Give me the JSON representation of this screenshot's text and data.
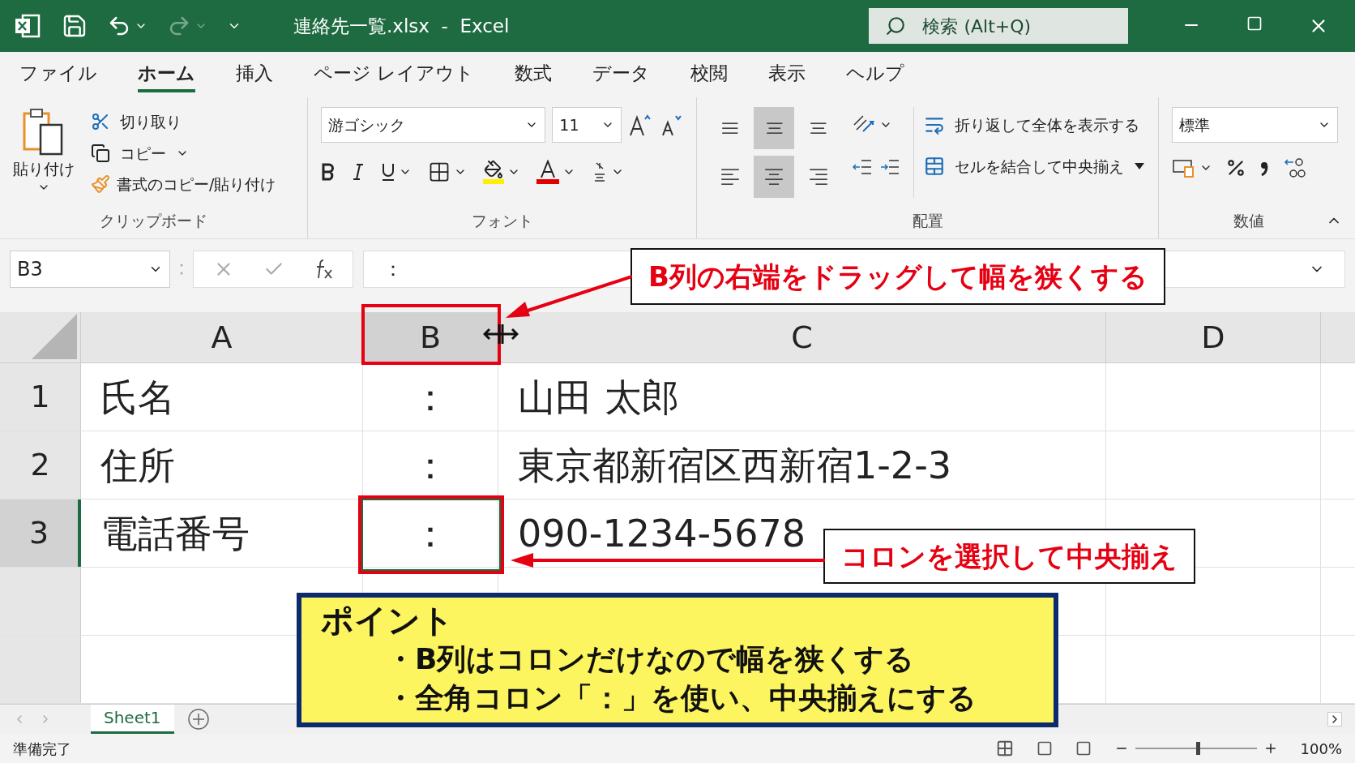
{
  "title_bar": {
    "title": "連絡先一覧.xlsx  -  Excel",
    "search_placeholder": "検索 (Alt+Q)"
  },
  "menu_tabs": [
    {
      "label": "ファイル",
      "selected": false
    },
    {
      "label": "ホーム",
      "selected": true
    },
    {
      "label": "挿入",
      "selected": false
    },
    {
      "label": "ページ レイアウト",
      "selected": false
    },
    {
      "label": "数式",
      "selected": false
    },
    {
      "label": "データ",
      "selected": false
    },
    {
      "label": "校閲",
      "selected": false
    },
    {
      "label": "表示",
      "selected": false
    },
    {
      "label": "ヘルプ",
      "selected": false
    }
  ],
  "clipboard": {
    "paste": "貼り付け",
    "cut": "切り取り",
    "copy": "コピー",
    "format_painter": "書式のコピー/貼り付け",
    "group_label": "クリップボード"
  },
  "font": {
    "name": "游ゴシック",
    "size": "11",
    "group_label": "フォント"
  },
  "alignment": {
    "buttons": [
      {
        "kind": "top",
        "selected": false
      },
      {
        "kind": "middle",
        "selected": true
      },
      {
        "kind": "bottom",
        "selected": false
      },
      {
        "kind": "left",
        "selected": false
      },
      {
        "kind": "center",
        "selected": true
      },
      {
        "kind": "right",
        "selected": false
      }
    ],
    "wrap": "折り返して全体を表示する",
    "merge": "セルを結合して中央揃え",
    "group_label": "配置"
  },
  "number": {
    "format": "標準",
    "group_label": "数値"
  },
  "formula_bar": {
    "name_box": "B3",
    "formula": "："
  },
  "columns": [
    {
      "label": "A",
      "selected": false
    },
    {
      "label": "B",
      "selected": true
    },
    {
      "label": "C",
      "selected": false
    },
    {
      "label": "D",
      "selected": false
    }
  ],
  "rows": [
    {
      "header": "1",
      "selected": false,
      "cells": [
        "氏名",
        "：",
        "山田 太郎"
      ]
    },
    {
      "header": "2",
      "selected": false,
      "cells": [
        "住所",
        "：",
        "東京都新宿区西新宿1-2-3"
      ]
    },
    {
      "header": "3",
      "selected": true,
      "cells": [
        "電話番号",
        "：",
        "090-1234-5678"
      ]
    }
  ],
  "callouts": [
    "B列の右端をドラッグして幅を狭くする",
    "コロンを選択して中央揃え"
  ],
  "point": {
    "title": "ポイント",
    "bullets": [
      "・B列はコロンだけなので幅を狭くする",
      "・全角コロン「：」を使い、中央揃えにする"
    ]
  },
  "sheet_tabs": [
    {
      "label": "Sheet1",
      "selected": true
    }
  ],
  "status_bar": {
    "text": "準備完了",
    "zoom": "100%",
    "zoom_slider": {
      "level": 0.5
    }
  }
}
